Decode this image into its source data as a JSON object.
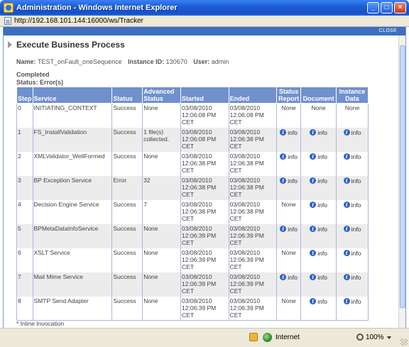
{
  "window": {
    "title": "Administration - Windows Internet Explorer",
    "url": "http://192.168.101.144:16000/ws/Tracker",
    "buttons": [
      "minimize",
      "maximize",
      "close"
    ]
  },
  "panel": {
    "close_label": "CLOSE",
    "heading": "Execute Business Process",
    "name_label": "Name:",
    "name_value": "TEST_onFault_oneSequence",
    "instance_label": "Instance ID:",
    "instance_value": "130670",
    "user_label": "User:",
    "user_value": "admin",
    "completed": "Completed",
    "status_line": "Status: Error(s)",
    "footnote": "* Inline Invocation"
  },
  "table": {
    "headers": {
      "step": "Step",
      "service": "Service",
      "status": "Status",
      "advanced_1": "Advanced",
      "advanced_2": "Status",
      "started": "Started",
      "ended": "Ended",
      "report_1": "Status",
      "report_2": "Report",
      "document": "Document",
      "instance_1": "Instance",
      "instance_2": "Data"
    },
    "rows": [
      {
        "step": "0",
        "service": "INITIATING_CONTEXT",
        "status": "Success",
        "advanced": "None",
        "started": "03/08/2010 12:06:08 PM CET",
        "ended": "03/08/2010 12:06:08 PM CET",
        "report": "None",
        "document": "None",
        "instance": "None"
      },
      {
        "step": "1",
        "service": "FS_InstallValidation",
        "status": "Success",
        "advanced": "1 file(s) collected.",
        "started": "03/08/2010 12:06:08 PM CET",
        "ended": "03/08/2010 12:06:38 PM CET",
        "report": "info",
        "document": "info",
        "instance": "info"
      },
      {
        "step": "2",
        "service": "XMLValidator_WellFormed",
        "status": "Success",
        "advanced": "None",
        "started": "03/08/2010 12:06:38 PM CET",
        "ended": "03/08/2010 12:06:38 PM CET",
        "report": "info",
        "document": "info",
        "instance": "info"
      },
      {
        "step": "3",
        "service": "BP Exception Service",
        "status": "Error",
        "advanced": "32",
        "started": "03/08/2010 12:06:38 PM CET",
        "ended": "03/08/2010 12:06:38 PM CET",
        "report": "info",
        "document": "info",
        "instance": "info"
      },
      {
        "step": "4",
        "service": "Decision Engine Service",
        "status": "Success",
        "advanced": "7",
        "started": "03/08/2010 12:06:38 PM CET",
        "ended": "03/08/2010 12:06:38 PM CET",
        "report": "None",
        "document": "info",
        "instance": "info"
      },
      {
        "step": "5",
        "service": "BPMetaDataInfoService",
        "status": "Success",
        "advanced": "None",
        "started": "03/08/2010 12:06:39 PM CET",
        "ended": "03/08/2010 12:06:39 PM CET",
        "report": "info",
        "document": "info",
        "instance": "info"
      },
      {
        "step": "6",
        "service": "XSLT Service",
        "status": "Success",
        "advanced": "None",
        "started": "03/08/2010 12:06:39 PM CET",
        "ended": "03/08/2010 12:06:39 PM CET",
        "report": "None",
        "document": "info",
        "instance": "info"
      },
      {
        "step": "7",
        "service": "Mail Mime Service",
        "status": "Success",
        "advanced": "None",
        "started": "03/08/2010 12:06:39 PM CET",
        "ended": "03/08/2010 12:06:39 PM CET",
        "report": "info",
        "document": "info",
        "instance": "info"
      },
      {
        "step": "8",
        "service": "SMTP Send Adapter",
        "status": "Success",
        "advanced": "None",
        "started": "03/08/2010 12:06:39 PM CET",
        "ended": "03/08/2010 12:06:39 PM CET",
        "report": "None",
        "document": "info",
        "instance": "info"
      }
    ]
  },
  "statusbar": {
    "zone": "Internet",
    "zoom": "100%"
  },
  "colors": {
    "header_bg": "#7090ce",
    "close_bar": "#3f6dc3",
    "title_bar": "#1d5fd6"
  }
}
